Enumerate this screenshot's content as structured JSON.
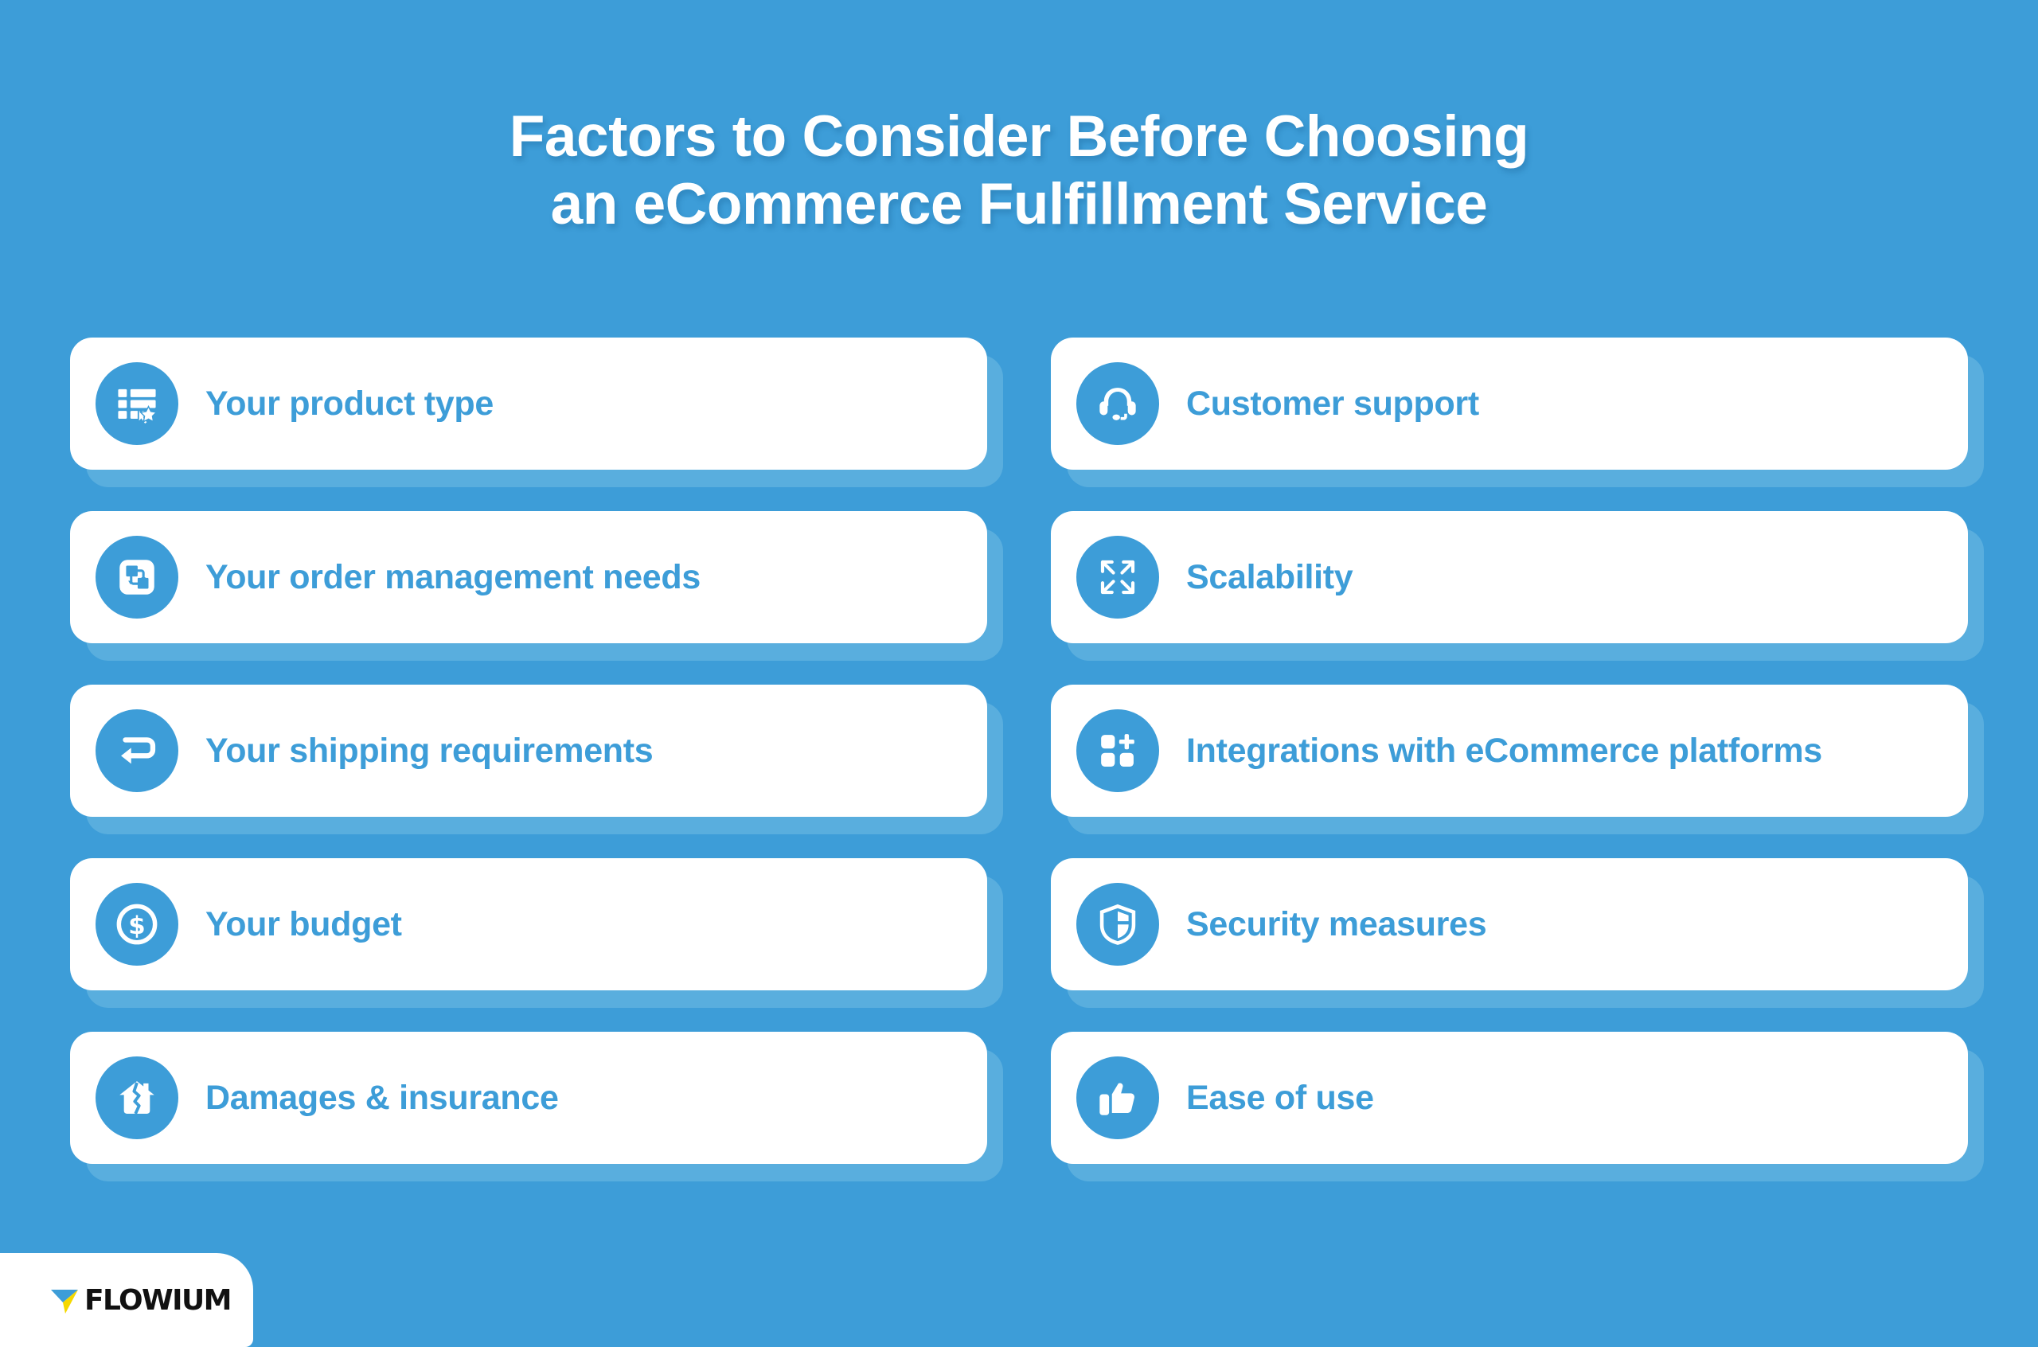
{
  "page": {
    "background_color": "#3d9dd8",
    "card_color": "#ffffff",
    "card_shadow_color": "#59aede",
    "accent_color": "#3d9dd8",
    "title_color": "#ffffff"
  },
  "title": {
    "line1": "Factors to Consider Before Choosing",
    "line2": "an eCommerce Fulfillment Service"
  },
  "cards": {
    "left": [
      {
        "label": "Your product type",
        "icon": "list-star-icon"
      },
      {
        "label": "Your order management needs",
        "icon": "order-transfer-icon"
      },
      {
        "label": "Your shipping requirements",
        "icon": "return-arrow-icon"
      },
      {
        "label": "Your budget",
        "icon": "dollar-circle-icon"
      },
      {
        "label": "Damages & insurance",
        "icon": "cracked-house-icon"
      }
    ],
    "right": [
      {
        "label": "Customer support",
        "icon": "headset-icon"
      },
      {
        "label": "Scalability",
        "icon": "expand-arrows-icon"
      },
      {
        "label": "Integrations with eCommerce platforms",
        "icon": "grid-plus-icon"
      },
      {
        "label": "Security measures",
        "icon": "shield-icon"
      },
      {
        "label": "Ease of use",
        "icon": "thumbs-up-icon"
      }
    ]
  },
  "logo": {
    "text": "FLOWIUM",
    "mark_top_color": "#3d9dd8",
    "mark_bottom_color": "#f5d800"
  }
}
